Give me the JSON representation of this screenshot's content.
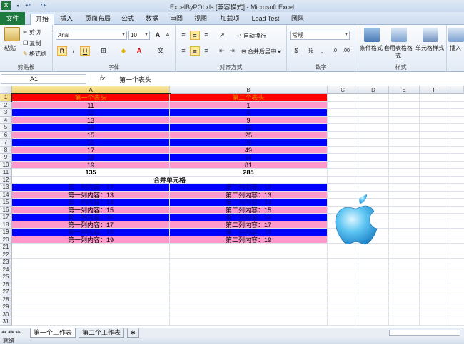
{
  "window": {
    "title": "ExcelByPOI.xls [兼容模式] - Microsoft Excel"
  },
  "ribbon": {
    "tabs": [
      {
        "label": "文件"
      },
      {
        "label": "开始"
      },
      {
        "label": "插入"
      },
      {
        "label": "页面布局"
      },
      {
        "label": "公式"
      },
      {
        "label": "数据"
      },
      {
        "label": "审阅"
      },
      {
        "label": "视图"
      },
      {
        "label": "加载项"
      },
      {
        "label": "Load Test"
      },
      {
        "label": "团队"
      }
    ],
    "active_tab": "开始",
    "clipboard": {
      "paste": "粘贴",
      "cut": "剪切",
      "copy": "复制",
      "format_painter": "格式刷",
      "label": "剪贴板"
    },
    "font": {
      "name": "Arial",
      "size": "10",
      "label": "字体",
      "bold": "B",
      "italic": "I",
      "underline": "U",
      "grow": "A",
      "shrink": "A"
    },
    "alignment": {
      "wrap": "自动换行",
      "merge": "合并后居中",
      "label": "对齐方式"
    },
    "number": {
      "format": "常规",
      "percent": "%",
      "comma": ",",
      "label": "数字"
    },
    "styles": {
      "conditional": "条件格式",
      "table": "套用表格格式",
      "cell": "单元格样式",
      "label": "样式"
    },
    "cells": {
      "insert": "插入"
    }
  },
  "formula_bar": {
    "name_box": "A1",
    "fx": "fx",
    "formula": "第一个表头"
  },
  "grid": {
    "columns": [
      "A",
      "B",
      "C",
      "D",
      "E",
      "F"
    ],
    "rows": [
      {
        "num": "1",
        "a": "第一个表头",
        "b": "第二个表头",
        "style": "header"
      },
      {
        "num": "2",
        "a": "11",
        "b": "1",
        "style": "pink"
      },
      {
        "num": "3",
        "a": "12",
        "b": "4",
        "style": "blue"
      },
      {
        "num": "4",
        "a": "13",
        "b": "9",
        "style": "pink"
      },
      {
        "num": "5",
        "a": "14",
        "b": "16",
        "style": "blue"
      },
      {
        "num": "6",
        "a": "15",
        "b": "25",
        "style": "pink"
      },
      {
        "num": "7",
        "a": "16",
        "b": "36",
        "style": "blue"
      },
      {
        "num": "8",
        "a": "17",
        "b": "49",
        "style": "pink"
      },
      {
        "num": "9",
        "a": "18",
        "b": "64",
        "style": "blue"
      },
      {
        "num": "10",
        "a": "19",
        "b": "81",
        "style": "pink"
      },
      {
        "num": "11",
        "a": "135",
        "b": "285",
        "style": "total"
      },
      {
        "num": "12",
        "a": "合并单元格",
        "b": "",
        "style": "merged"
      },
      {
        "num": "13",
        "a": "第一列内容：12",
        "b": "第二列内容：12",
        "style": "blue"
      },
      {
        "num": "14",
        "a": "第一列内容：13",
        "b": "第二列内容：13",
        "style": "pink"
      },
      {
        "num": "15",
        "a": "第一列内容：14",
        "b": "第二列内容：14",
        "style": "blue"
      },
      {
        "num": "16",
        "a": "第一列内容：15",
        "b": "第二列内容：15",
        "style": "pink"
      },
      {
        "num": "17",
        "a": "第一列内容：16",
        "b": "第二列内容：16",
        "style": "blue"
      },
      {
        "num": "18",
        "a": "第一列内容：17",
        "b": "第二列内容：17",
        "style": "pink"
      },
      {
        "num": "19",
        "a": "第一列内容：18",
        "b": "第二列内容：18",
        "style": "blue"
      },
      {
        "num": "20",
        "a": "第一列内容：19",
        "b": "第二列内容：19",
        "style": "pink"
      },
      {
        "num": "21",
        "a": "",
        "b": "",
        "style": "empty"
      },
      {
        "num": "22",
        "a": "",
        "b": "",
        "style": "empty"
      },
      {
        "num": "23",
        "a": "",
        "b": "",
        "style": "empty"
      },
      {
        "num": "24",
        "a": "",
        "b": "",
        "style": "empty"
      },
      {
        "num": "25",
        "a": "",
        "b": "",
        "style": "empty"
      },
      {
        "num": "26",
        "a": "",
        "b": "",
        "style": "empty"
      },
      {
        "num": "27",
        "a": "",
        "b": "",
        "style": "empty"
      },
      {
        "num": "28",
        "a": "",
        "b": "",
        "style": "empty"
      },
      {
        "num": "29",
        "a": "",
        "b": "",
        "style": "empty"
      },
      {
        "num": "30",
        "a": "",
        "b": "",
        "style": "empty"
      },
      {
        "num": "31",
        "a": "",
        "b": "",
        "style": "empty"
      }
    ],
    "colors": {
      "header": "#ff0000",
      "header_text": "#e08a00",
      "pink": "#ff99cc",
      "blue": "#0000ff"
    }
  },
  "sheets": [
    {
      "label": "第一个工作表"
    },
    {
      "label": "第二个工作表"
    }
  ],
  "status": "就绪"
}
